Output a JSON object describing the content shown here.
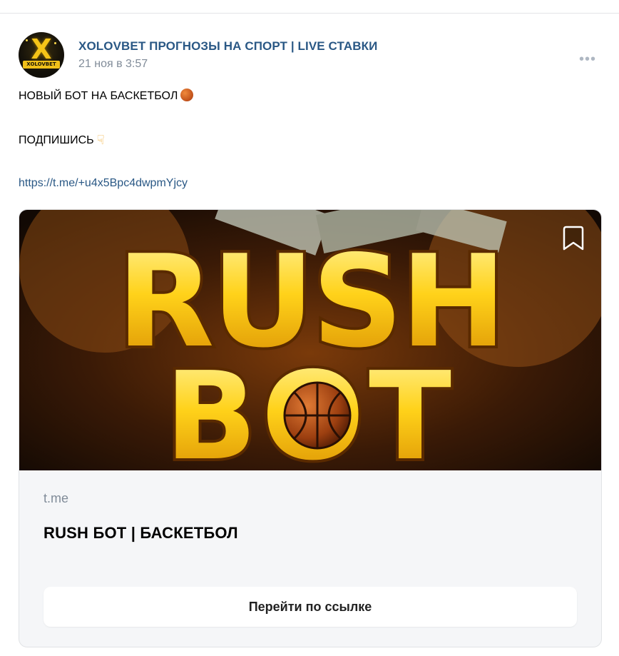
{
  "post": {
    "group_name": "XOLOVBET ПРОГНОЗЫ НА СПОРТ | LIVE СТАВКИ",
    "date": "21 ноя в 3:57",
    "more_label": "•••",
    "avatar": {
      "letter": "X",
      "band_text": "XOLOVBET"
    },
    "lines": [
      "НОВЫЙ БОТ НА БАСКЕТБОЛ",
      "ПОДПИШИСЬ"
    ],
    "emoji_icons": [
      "basketball-icon",
      "pointing-down-icon"
    ],
    "link": "https://t.me/+u4x5Bpc4dwpmYjcy"
  },
  "card": {
    "image_text_line1": "RUSH",
    "image_text_line2": "BOT",
    "domain": "t.me",
    "title": "RUSH БОТ | БАСКЕТБОЛ",
    "button_label": "Перейти по ссылке"
  },
  "colors": {
    "link": "#2a5885",
    "secondary_text": "#818c99",
    "gold": "#f5c418"
  }
}
